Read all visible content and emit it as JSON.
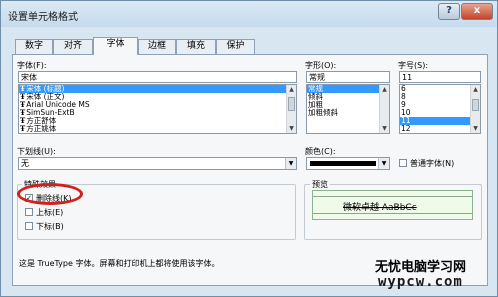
{
  "window": {
    "title": "设置单元格格式",
    "help": "?",
    "close": "x"
  },
  "tabs": [
    "数字",
    "对齐",
    "字体",
    "边框",
    "填充",
    "保护"
  ],
  "font": {
    "label": "字体(F):",
    "value": "宋体",
    "items": [
      "宋体 (标题)",
      "宋体 (正文)",
      "Arial Unicode MS",
      "SimSun-ExtB",
      "方正舒体",
      "方正姚体"
    ],
    "selected_index": 0,
    "tt_glyph": "Ŧ"
  },
  "style": {
    "label": "字形(O):",
    "value": "常规",
    "items": [
      "常规",
      "倾斜",
      "加粗",
      "加粗倾斜"
    ],
    "selected_index": 0
  },
  "size": {
    "label": "字号(S):",
    "value": "11",
    "items": [
      "6",
      "8",
      "9",
      "10",
      "11",
      "12"
    ],
    "selected_index": 4
  },
  "underline": {
    "label": "下划线(U):",
    "value": "无"
  },
  "color": {
    "label": "颜色(C):",
    "swatch": "#000000"
  },
  "normal_font": {
    "label": "普通字体(N)"
  },
  "effects": {
    "legend": "特殊效果",
    "strike": "删除线(K)",
    "strike_checked": true,
    "super": "上标(E)",
    "sub": "下标(B)"
  },
  "preview": {
    "legend": "预览",
    "sample": "微软卓越  AaBbCc"
  },
  "note": "这是 TrueType 字体。屏幕和打印机上都将使用该字体。",
  "watermark": {
    "line1": "无忧电脑学习网",
    "line2": "wypcw.com"
  },
  "icons": {
    "arrow_down": "▼",
    "arrow_up": "▲",
    "check": "✓"
  }
}
